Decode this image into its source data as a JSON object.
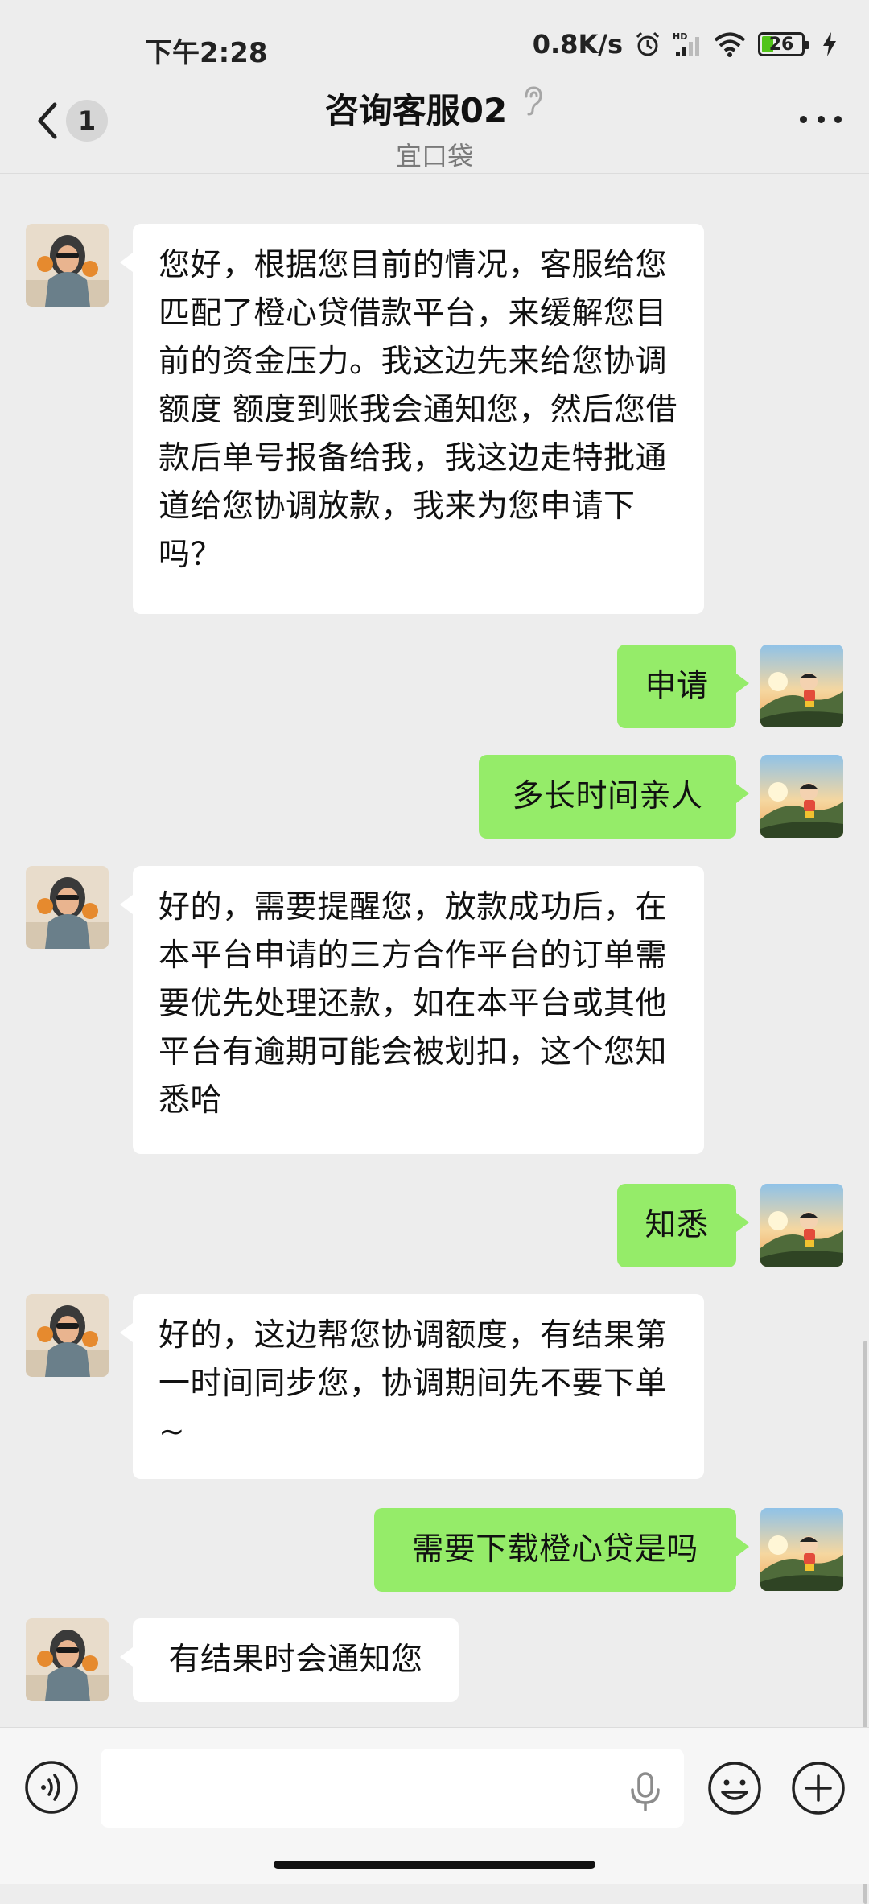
{
  "status_bar": {
    "time": "下午2:28",
    "net_speed": "0.8K/s",
    "battery": "26",
    "icons": [
      "alarm-icon",
      "hd-signal-icon",
      "wifi-icon",
      "battery-icon",
      "charging-icon"
    ]
  },
  "header": {
    "unread_count": "1",
    "title": "咨询客服02",
    "subtitle": "宜口袋",
    "icons": [
      "back-arrow-icon",
      "ear-icon",
      "more-icon"
    ]
  },
  "messages": [
    {
      "side": "left",
      "text": "您好，根据您目前的情况，客服给您匹配了橙心贷借款平台，来缓解您目前的资金压力。我这边先来给您协调额度 额度到账我会通知您，然后您借款后单号报备给我，我这边走特批通道给您协调放款，我来为您申请下吗？"
    },
    {
      "side": "right",
      "text": "申请"
    },
    {
      "side": "right",
      "text": "多长时间亲人"
    },
    {
      "side": "left",
      "text": "好的，需要提醒您，放款成功后，在本平台申请的三方合作平台的订单需要优先处理还款，如在本平台或其他平台有逾期可能会被划扣，这个您知悉哈"
    },
    {
      "side": "right",
      "text": "知悉"
    },
    {
      "side": "left",
      "text": "好的，这边帮您协调额度，有结果第一时间同步您，协调期间先不要下单~"
    },
    {
      "side": "right",
      "text": "需要下载橙心贷是吗"
    },
    {
      "side": "left",
      "text": "有结果时会通知您"
    }
  ],
  "input_bar": {
    "icons": [
      "voice-icon",
      "microphone-icon",
      "emoji-icon",
      "plus-icon"
    ]
  },
  "colors": {
    "background": "#ededed",
    "bubble_self": "#95ec69",
    "bubble_other": "#ffffff",
    "battery_fill": "#52c41a"
  }
}
